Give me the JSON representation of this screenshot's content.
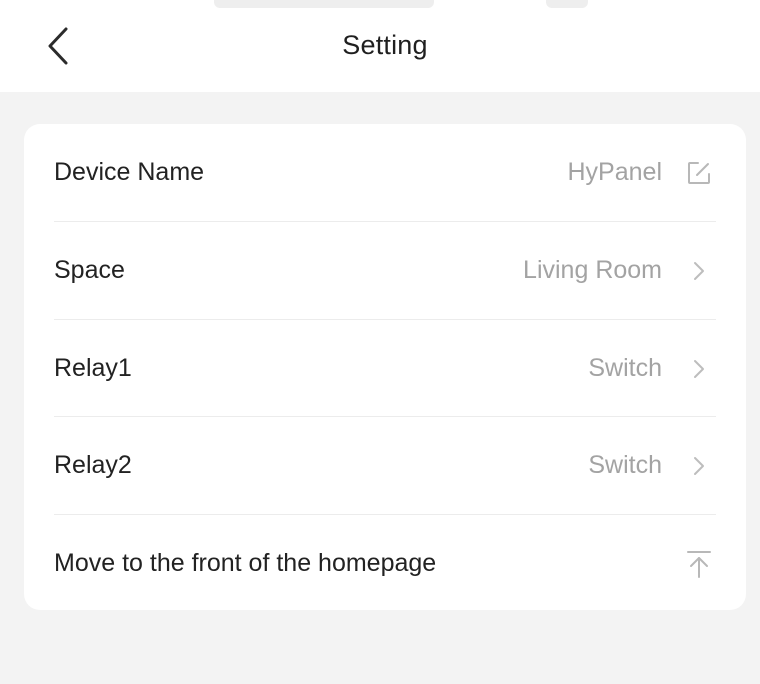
{
  "header": {
    "title": "Setting",
    "back_icon": "chevron-left-icon"
  },
  "settings": {
    "rows": [
      {
        "label": "Device Name",
        "value": "HyPanel",
        "icon": "edit-icon"
      },
      {
        "label": "Space",
        "value": "Living Room",
        "icon": "chevron-right-icon"
      },
      {
        "label": "Relay1",
        "value": "Switch",
        "icon": "chevron-right-icon"
      },
      {
        "label": "Relay2",
        "value": "Switch",
        "icon": "chevron-right-icon"
      },
      {
        "label": "Move to the front of the homepage",
        "value": "",
        "icon": "move-to-top-icon"
      }
    ]
  },
  "colors": {
    "page_background": "#f3f3f3",
    "card_background": "#ffffff",
    "label_text": "#222222",
    "value_text": "#a3a3a3",
    "icon_gray": "#b5b5b5"
  }
}
